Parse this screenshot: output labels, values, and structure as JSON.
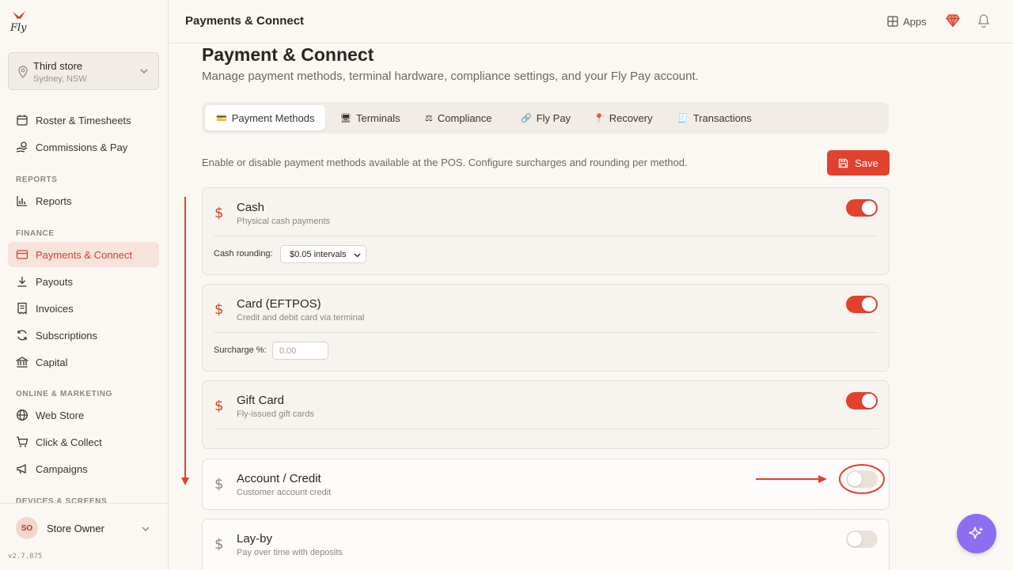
{
  "app": {
    "logo_text": "Fly",
    "version": "v2.7.875"
  },
  "store": {
    "name": "Third store",
    "location": "Sydney, NSW"
  },
  "sidebar": {
    "items_top": [
      {
        "label": "Roster & Timesheets",
        "icon": "calendar-icon"
      },
      {
        "label": "Commissions & Pay",
        "icon": "hand-coins-icon"
      }
    ],
    "sections": [
      {
        "heading": "REPORTS",
        "items": [
          {
            "label": "Reports",
            "icon": "bar-chart-icon"
          }
        ]
      },
      {
        "heading": "FINANCE",
        "items": [
          {
            "label": "Payments & Connect",
            "icon": "credit-card-icon",
            "active": true
          },
          {
            "label": "Payouts",
            "icon": "download-icon"
          },
          {
            "label": "Invoices",
            "icon": "invoice-icon"
          },
          {
            "label": "Subscriptions",
            "icon": "refresh-icon"
          },
          {
            "label": "Capital",
            "icon": "bank-icon"
          }
        ]
      },
      {
        "heading": "ONLINE & MARKETING",
        "items": [
          {
            "label": "Web Store",
            "icon": "globe-icon"
          },
          {
            "label": "Click & Collect",
            "icon": "cart-icon"
          },
          {
            "label": "Campaigns",
            "icon": "megaphone-icon"
          }
        ]
      },
      {
        "heading": "DEVICES & SCREENS",
        "items": []
      }
    ],
    "user": {
      "initials": "SO",
      "name": "Store Owner"
    }
  },
  "header": {
    "title": "Payments & Connect",
    "apps_label": "Apps"
  },
  "page": {
    "title": "Payment & Connect",
    "subtitle": "Manage payment methods, terminal hardware, compliance settings, and your Fly Pay account.",
    "tabs": [
      {
        "label": "Payment Methods",
        "glyph": "💳",
        "active": true
      },
      {
        "label": "Terminals",
        "glyph": "🖥"
      },
      {
        "label": "Compliance",
        "glyph": "⚖"
      },
      {
        "label": "Fly Pay",
        "glyph": "🔗"
      },
      {
        "label": "Recovery",
        "glyph": "📍"
      },
      {
        "label": "Transactions",
        "glyph": "🧾"
      }
    ],
    "description": "Enable or disable payment methods available at the POS. Configure surcharges and rounding per method.",
    "save_label": "Save"
  },
  "methods": [
    {
      "name": "Cash",
      "sub": "Physical cash payments",
      "enabled": true,
      "field_label": "Cash rounding:",
      "field_value": "$0.05 intervals"
    },
    {
      "name": "Card (EFTPOS)",
      "sub": "Credit and debit card via terminal",
      "enabled": true,
      "field_label": "Surcharge %:",
      "field_placeholder": "0.00"
    },
    {
      "name": "Gift Card",
      "sub": "Fly-issued gift cards",
      "enabled": true
    },
    {
      "name": "Account / Credit",
      "sub": "Customer account credit",
      "enabled": false
    },
    {
      "name": "Lay-by",
      "sub": "Pay over time with deposits",
      "enabled": false
    }
  ],
  "colors": {
    "accent": "#e2412d",
    "active_bg": "#f6e3dc",
    "fab": "#8d6ef0"
  }
}
